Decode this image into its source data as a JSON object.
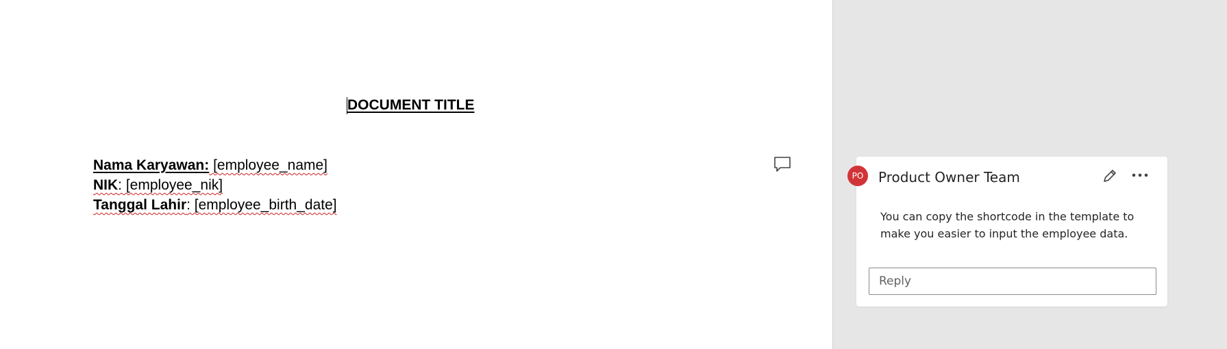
{
  "document": {
    "title": "DOCUMENT TITLE",
    "fields": [
      {
        "label": "Nama Karyawan:",
        "value": " [employee_name]"
      },
      {
        "label": "NIK",
        "value": ": [employee_nik]"
      },
      {
        "label": "Tanggal Lahir",
        "value": ": [employee_birth_date]"
      }
    ]
  },
  "comment": {
    "author_initials": "PO",
    "author_name": "Product Owner Team",
    "text": "You can copy the shortcode in the template to make you easier to input the employee data.",
    "reply_placeholder": "Reply",
    "avatar_color": "#d13438",
    "icons": {
      "marker": "comment-icon",
      "edit": "pencil-icon",
      "more": "more-options-icon"
    }
  },
  "colors": {
    "pane_background": "#e6e6e6",
    "spelling_squiggle": "#d02020"
  }
}
